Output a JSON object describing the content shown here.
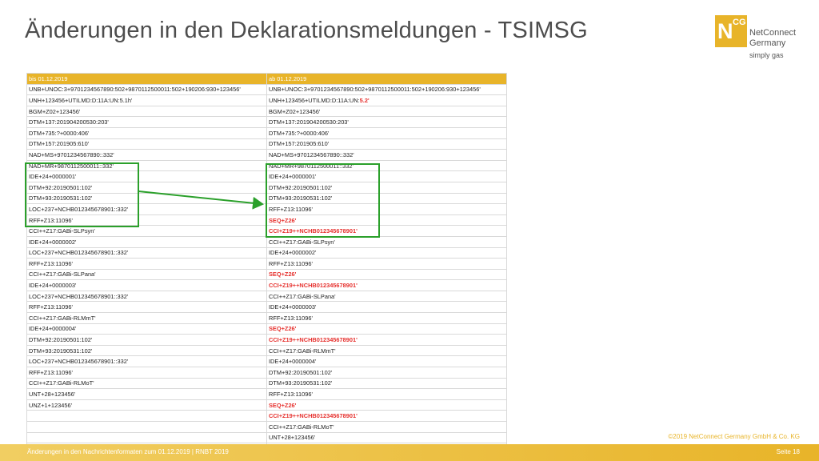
{
  "slide": {
    "title": "Änderungen in den Deklarationsmeldungen - TSIMSG"
  },
  "logo": {
    "mark": "N",
    "mark_sup": "CG",
    "line1": "NetConnect",
    "line2": "Germany",
    "tagline": "simply gas",
    "brand_color": "#e8b429"
  },
  "table": {
    "headers": [
      "bis 01.12.2019",
      "ab 01.12.2019"
    ],
    "rows": [
      [
        {
          "t": "UNB+UNOC:3+9701234567890:502+9870112500011:502+190206:930+123456'"
        },
        {
          "t": "UNB+UNOC:3+9701234567890:502+9870112500011:502+190206:930+123456'"
        }
      ],
      [
        {
          "t": "UNH+123456+UTILMD:D:11A:UN:5.1h'"
        },
        {
          "t": "UNH+123456+UTILMD:D:11A:UN:",
          "r": "5.2'"
        }
      ],
      [
        {
          "t": "BGM+Z02+123456'"
        },
        {
          "t": "BGM+Z02+123456'"
        }
      ],
      [
        {
          "t": "DTM+137:201904200530:203'"
        },
        {
          "t": "DTM+137:201904200530:203'"
        }
      ],
      [
        {
          "t": "DTM+735:?+0000:406'"
        },
        {
          "t": "DTM+735:?+0000:406'"
        }
      ],
      [
        {
          "t": "DTM+157:201905:610'"
        },
        {
          "t": "DTM+157:201905:610'"
        }
      ],
      [
        {
          "t": "NAD+MS+9701234567890::332'"
        },
        {
          "t": "NAD+MS+9701234567890::332'"
        }
      ],
      [
        {
          "t": "NAD+MR+9870112500011::332'"
        },
        {
          "t": "NAD+MR+9870112500011::332'"
        }
      ],
      [
        {
          "t": "IDE+24+0000001'"
        },
        {
          "t": "IDE+24+0000001'"
        }
      ],
      [
        {
          "t": "DTM+92:20190501:102'"
        },
        {
          "t": "DTM+92:20190501:102'"
        }
      ],
      [
        {
          "t": "DTM+93:20190531:102'"
        },
        {
          "t": "DTM+93:20190531:102'"
        }
      ],
      [
        {
          "t": "LOC+237+NCHB012345678901::332'"
        },
        {
          "t": "RFF+Z13:11096'"
        }
      ],
      [
        {
          "t": "RFF+Z13:11096'"
        },
        {
          "t": "",
          "r": "SEQ+Z26'"
        }
      ],
      [
        {
          "t": "CCI++Z17:GABi-SLPsyn'"
        },
        {
          "t": "",
          "r": "CCI+Z19++NCHB012345678901'"
        }
      ],
      [
        {
          "t": "IDE+24+0000002'"
        },
        {
          "t": "CCI++Z17:GABi-SLPsyn'"
        }
      ],
      [
        {
          "t": "LOC+237+NCHB012345678901::332'"
        },
        {
          "t": "IDE+24+0000002'"
        }
      ],
      [
        {
          "t": "RFF+Z13:11096'"
        },
        {
          "t": "RFF+Z13:11096'"
        }
      ],
      [
        {
          "t": "CCI++Z17:GABi-SLPana'"
        },
        {
          "t": "",
          "r": "SEQ+Z26'"
        }
      ],
      [
        {
          "t": "IDE+24+0000003'"
        },
        {
          "t": "",
          "r": "CCI+Z19++NCHB012345678901'"
        }
      ],
      [
        {
          "t": "LOC+237+NCHB012345678901::332'"
        },
        {
          "t": "CCI++Z17:GABi-SLPana'"
        }
      ],
      [
        {
          "t": "RFF+Z13:11096'"
        },
        {
          "t": "IDE+24+0000003'"
        }
      ],
      [
        {
          "t": "CCI++Z17:GABi-RLMmT'"
        },
        {
          "t": "RFF+Z13:11096'"
        }
      ],
      [
        {
          "t": "IDE+24+0000004'"
        },
        {
          "t": "",
          "r": "SEQ+Z26'"
        }
      ],
      [
        {
          "t": "DTM+92:20190501:102'"
        },
        {
          "t": "",
          "r": "CCI+Z19++NCHB012345678901'"
        }
      ],
      [
        {
          "t": "DTM+93:20190531:102'"
        },
        {
          "t": "CCI++Z17:GABi-RLMmT'"
        }
      ],
      [
        {
          "t": "LOC+237+NCHB012345678901::332'"
        },
        {
          "t": "IDE+24+0000004'"
        }
      ],
      [
        {
          "t": "RFF+Z13:11096'"
        },
        {
          "t": "DTM+92:20190501:102'"
        }
      ],
      [
        {
          "t": "CCI++Z17:GABi-RLMoT'"
        },
        {
          "t": "DTM+93:20190531:102'"
        }
      ],
      [
        {
          "t": "UNT+28+123456'"
        },
        {
          "t": "RFF+Z13:11096'"
        }
      ],
      [
        {
          "t": "UNZ+1+123456'"
        },
        {
          "t": "",
          "r": "SEQ+Z26'"
        }
      ],
      [
        {
          "t": ""
        },
        {
          "t": "",
          "r": "CCI+Z19++NCHB012345678901'"
        }
      ],
      [
        {
          "t": ""
        },
        {
          "t": "CCI++Z17:GABi-RLMoT'"
        }
      ],
      [
        {
          "t": ""
        },
        {
          "t": "UNT+28+123456'"
        }
      ],
      [
        {
          "t": ""
        },
        {
          "t": "UNZ+1+123456'"
        }
      ]
    ]
  },
  "colors": {
    "highlight": "#2ba02b",
    "changed_text": "#e6312e",
    "header_fill": "#e8b429"
  },
  "footer": {
    "left": "Änderungen in den Nachrichtenformaten zum 01.12.2019  |  RNBT 2019",
    "page": "Seite 18",
    "copyright": "©2019 NetConnect Germany GmbH & Co. KG"
  }
}
